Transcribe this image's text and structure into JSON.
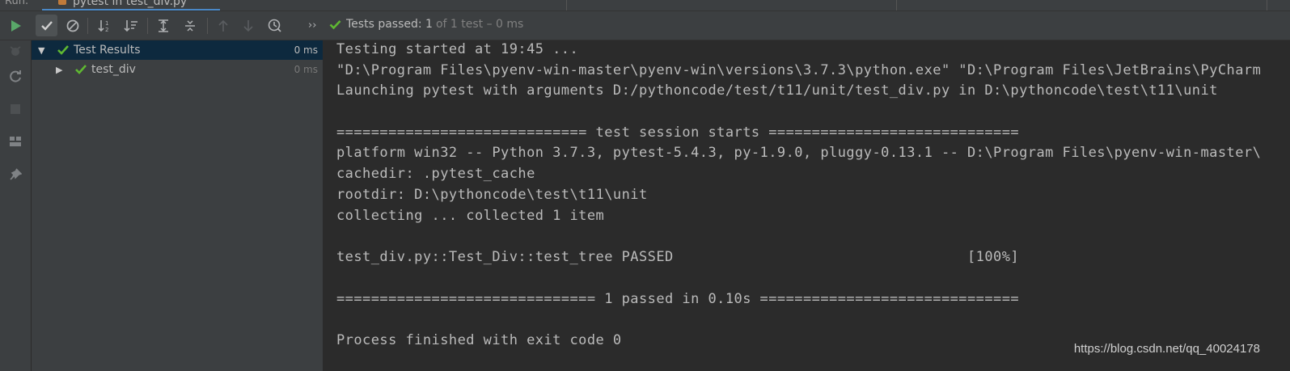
{
  "tabstrip": {
    "run_label": "Run:",
    "tab_title": "pytest in test_div.py",
    "tab_close": "×"
  },
  "toolbar": {
    "more_glyph": "››",
    "status_main": "Tests passed: 1",
    "status_count": "of 1 test – 0 ms"
  },
  "tree": {
    "root": {
      "label": "Test Results",
      "time": "0 ms",
      "status": "passed",
      "expanded": true
    },
    "children": [
      {
        "label": "test_div",
        "time": "0 ms",
        "status": "passed",
        "expanded": false
      }
    ]
  },
  "console": {
    "lines": [
      "Testing started at 19:45 ...",
      "\"D:\\Program Files\\pyenv-win-master\\pyenv-win\\versions\\3.7.3\\python.exe\" \"D:\\Program Files\\JetBrains\\PyCharm",
      "Launching pytest with arguments D:/pythoncode/test/t11/unit/test_div.py in D:\\pythoncode\\test\\t11\\unit",
      "",
      "============================= test session starts =============================",
      "platform win32 -- Python 3.7.3, pytest-5.4.3, py-1.9.0, pluggy-0.13.1 -- D:\\Program Files\\pyenv-win-master\\",
      "cachedir: .pytest_cache",
      "rootdir: D:\\pythoncode\\test\\t11\\unit",
      "collecting ... collected 1 item",
      "",
      "test_div.py::Test_Div::test_tree PASSED                                  [100%]",
      "",
      "============================== 1 passed in 0.10s ==============================",
      "",
      "Process finished with exit code 0"
    ]
  },
  "watermark": "https://blog.csdn.net/qq_40024178",
  "colors": {
    "pass_green": "#5fb832",
    "run_green": "#59a869",
    "selection": "#0d293e",
    "panel": "#3c3f41",
    "console_bg": "#2b2b2b"
  }
}
